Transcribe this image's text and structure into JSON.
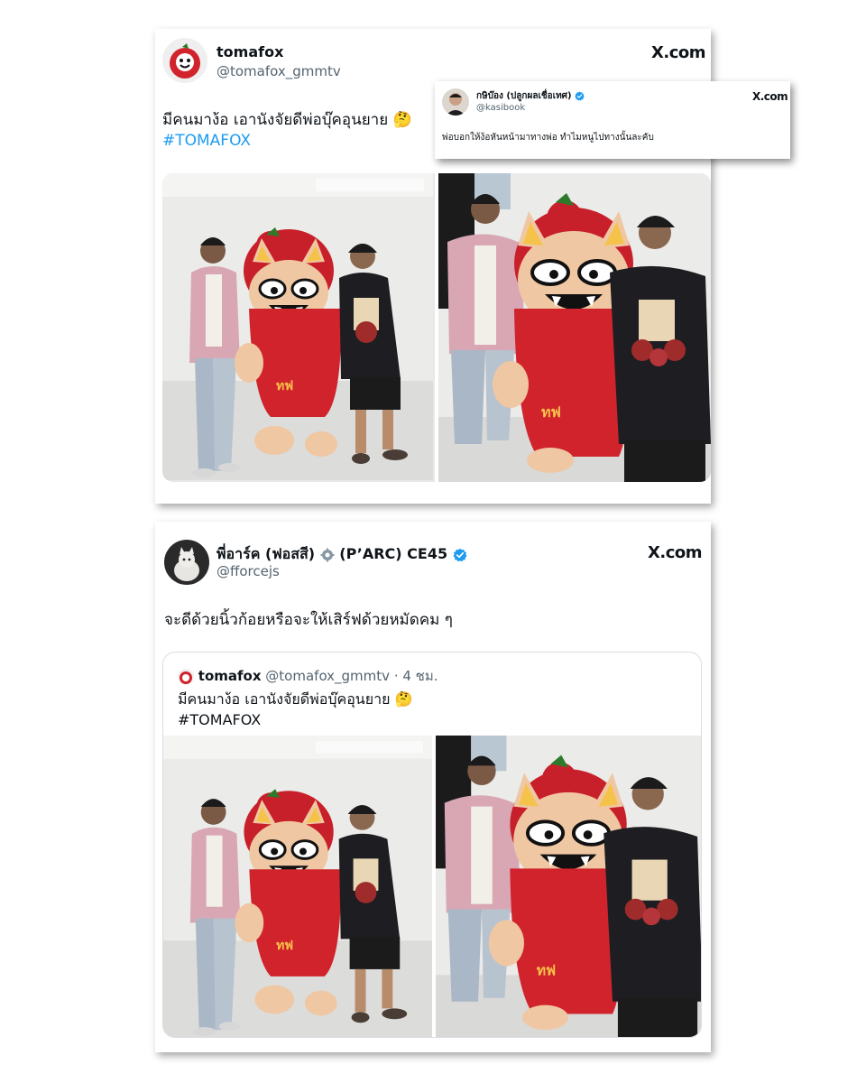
{
  "colors": {
    "accent": "#1d9bf0",
    "verified": "#1d9bf0",
    "text": "#0f1419",
    "muted": "#536471",
    "mascot_red": "#c8202a"
  },
  "tweet1": {
    "name": "tomafox",
    "handle": "@tomafox_gmmtv",
    "source": "X.com",
    "text": "มีคนมาง้อ เอานังจัยดีพ่อบุ๊คอุนยาย 🤔",
    "hashtag": "#TOMAFOX",
    "photos": [
      "photo-1",
      "photo-2"
    ]
  },
  "reply": {
    "name": "กษิบ๊อง (ปลูกผลเชื่อเทศ)",
    "handle": "@kasibook",
    "source": "X.com",
    "text": "พ่อบอกให้ง้อหันหน้ามาทางพ่อ ทำไมหนูไปทางนั้นละคับ"
  },
  "tweet2": {
    "name": "พี่อาร์ค (ฟอสสี)",
    "name_suffix": "(P’ARC) CE45",
    "handle": "@fforcejs",
    "source": "X.com",
    "text": "จะดีด้วยนิ้วก้อยหรือจะให้เสิร์ฟด้วยหมัดคม ๆ",
    "quote": {
      "name": "tomafox",
      "handle": "@tomafox_gmmtv",
      "time": "· 4 ชม.",
      "text": "มีคนมาง้อ เอานังจัยดีพ่อบุ๊คอุนยาย 🤔",
      "hashtag": "#TOMAFOX"
    }
  }
}
